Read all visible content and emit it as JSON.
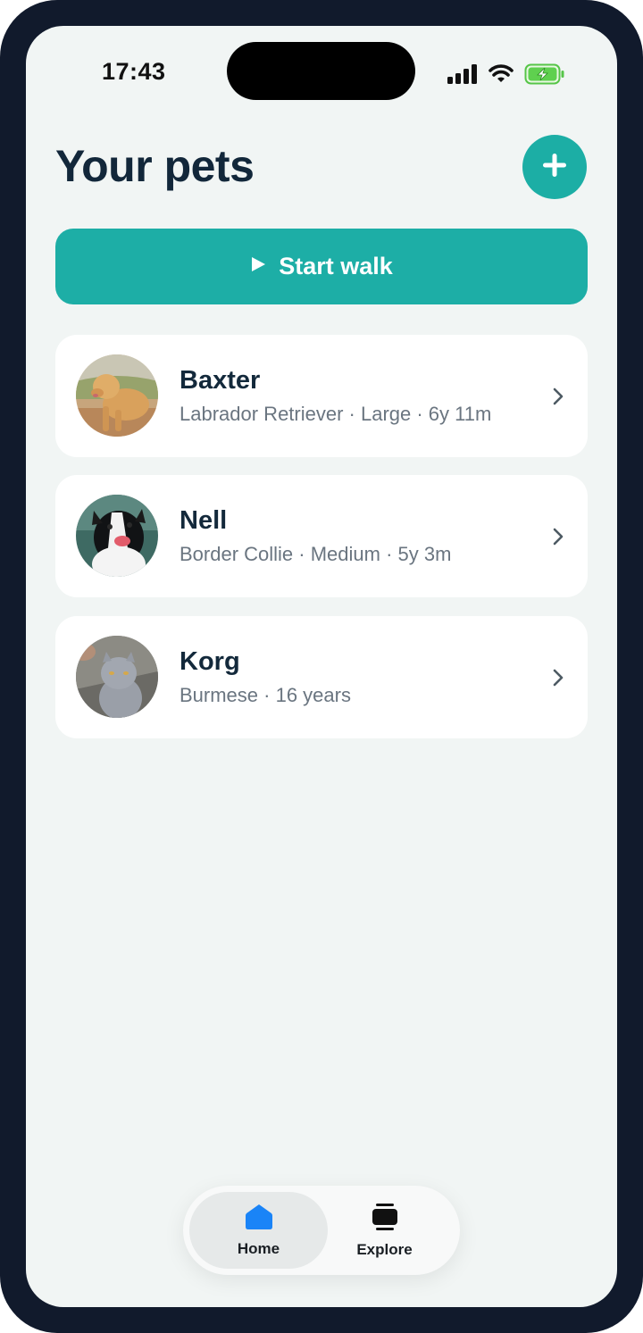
{
  "status_bar": {
    "time": "17:43"
  },
  "header": {
    "title": "Your pets",
    "add_icon": "plus-icon"
  },
  "start_walk": {
    "label": "Start walk",
    "icon": "play-icon"
  },
  "pets": [
    {
      "name": "Baxter",
      "details": "Labrador Retriever · Large · 6y 11m"
    },
    {
      "name": "Nell",
      "details": "Border Collie · Medium · 5y 3m"
    },
    {
      "name": "Korg",
      "details": "Burmese · 16 years"
    }
  ],
  "tabbar": {
    "tabs": [
      {
        "label": "Home",
        "icon": "home-icon",
        "active": true
      },
      {
        "label": "Explore",
        "icon": "explore-icon",
        "active": false
      }
    ]
  },
  "colors": {
    "accent": "#1daea6",
    "title": "#12273a",
    "background": "#f1f5f4",
    "home_icon_active": "#1a84f7"
  }
}
